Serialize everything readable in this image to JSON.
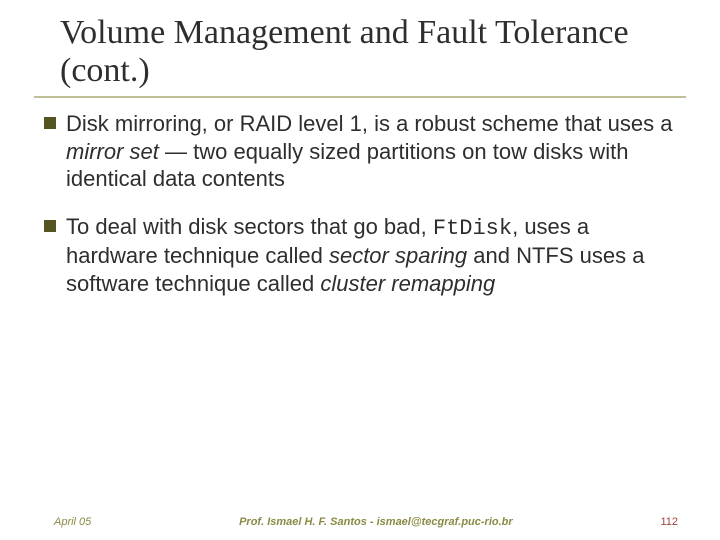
{
  "title": "Volume Management and Fault Tolerance (cont.)",
  "bullets": [
    {
      "lead": "Disk mirroring, or RAID level 1, is a robust scheme that uses a ",
      "ital1": "mirror set",
      "rest": " — two equally sized partitions on tow disks with identical data contents"
    },
    {
      "lead": "To deal with disk sectors that go bad, ",
      "code": "FtDisk",
      "mid": ", uses a hardware technique called ",
      "ital1": "sector sparing",
      "mid2": " and NTFS uses a software technique called ",
      "ital2": "cluster remapping"
    }
  ],
  "footer": {
    "left": "April 05",
    "center": "Prof. Ismael H. F. Santos - ismael@tecgraf.puc-rio.br",
    "right": "112"
  }
}
